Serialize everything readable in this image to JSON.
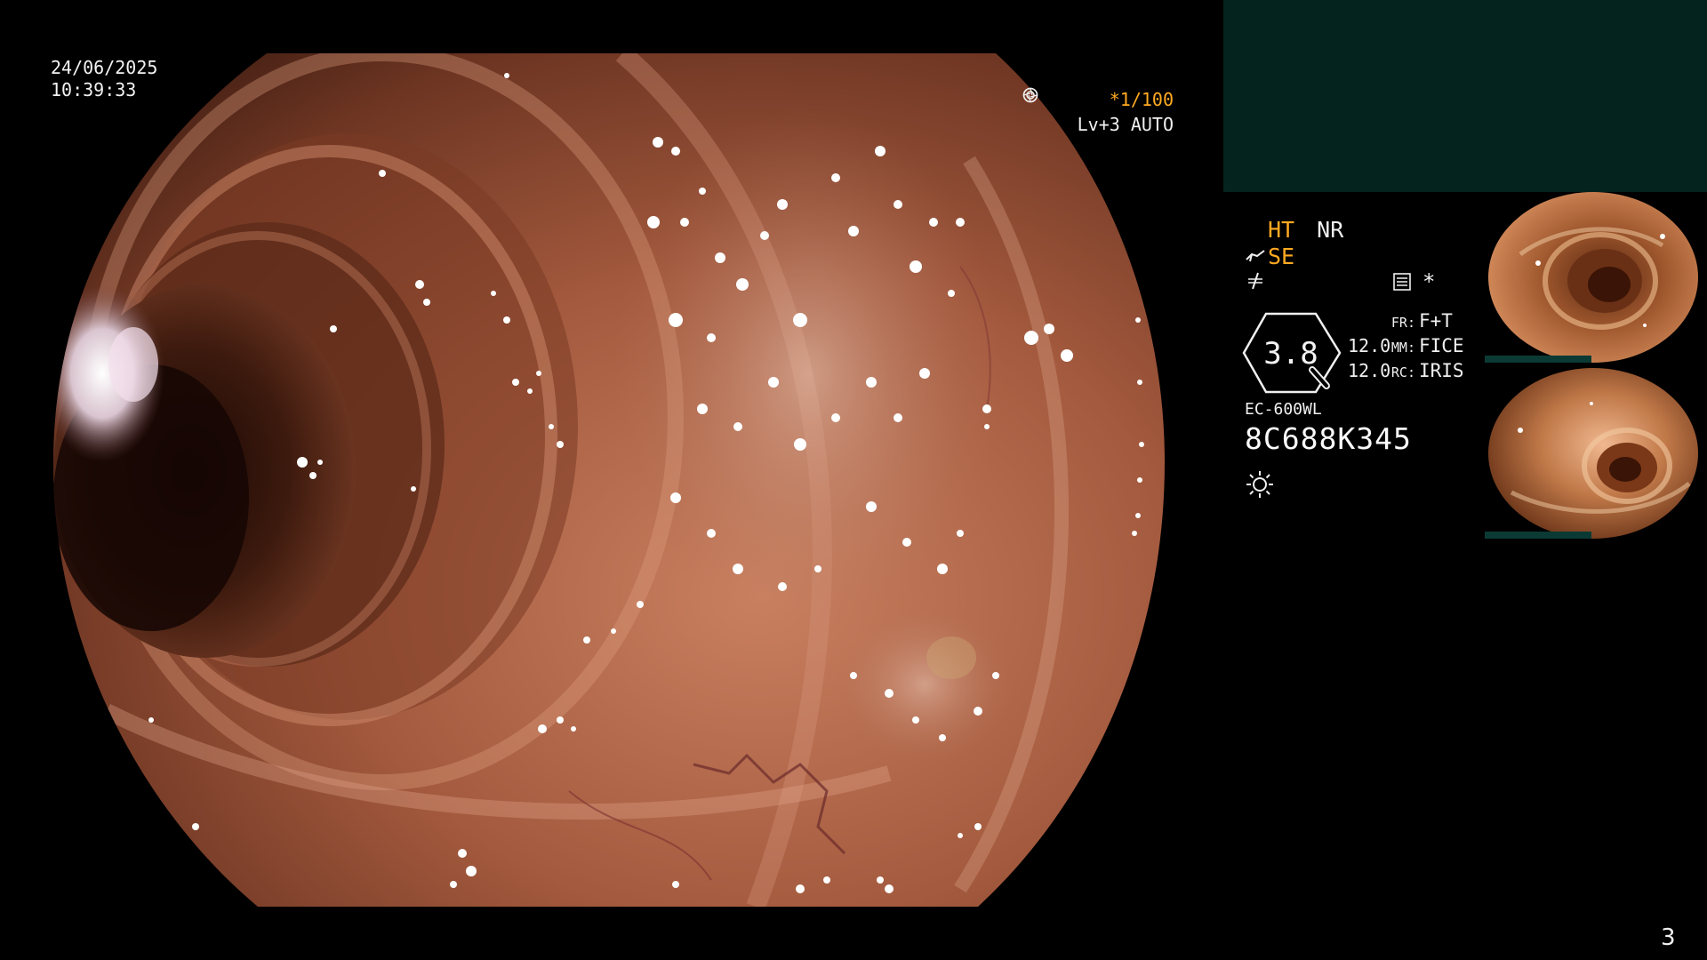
{
  "osd": {
    "date": "24/06/2025",
    "time": "10:39:33",
    "shutter": "*1/100",
    "shutter_icon": "aperture-icon",
    "level": "Lv+3 AUTO",
    "level_icon": "iris-icon"
  },
  "status": {
    "mode_ht": "HT",
    "mode_nr": "NR",
    "structure_enhance": "SE",
    "structure_icon": "enhance-arrow-icon",
    "filter_icon": "slash-icon",
    "record_icon": "document-icon",
    "record_star": "*",
    "zoom": "3.8",
    "params": [
      {
        "num": "",
        "key": "FR:",
        "value": "F+T"
      },
      {
        "num": "12.0",
        "key": "MM:",
        "value": "FICE"
      },
      {
        "num": "12.0",
        "key": "RC:",
        "value": "IRIS"
      }
    ],
    "scope_model": "EC-600WL",
    "scope_serial": "8C688K345",
    "light_icon": "sun-icon"
  },
  "thumbnails": [
    {
      "name": "capture-thumbnail-1"
    },
    {
      "name": "capture-thumbnail-2"
    }
  ],
  "colors": {
    "accent_orange": "#ffaa22",
    "panel_teal": "#04231f",
    "mucosa": "#b8684a"
  },
  "page_number": "3"
}
